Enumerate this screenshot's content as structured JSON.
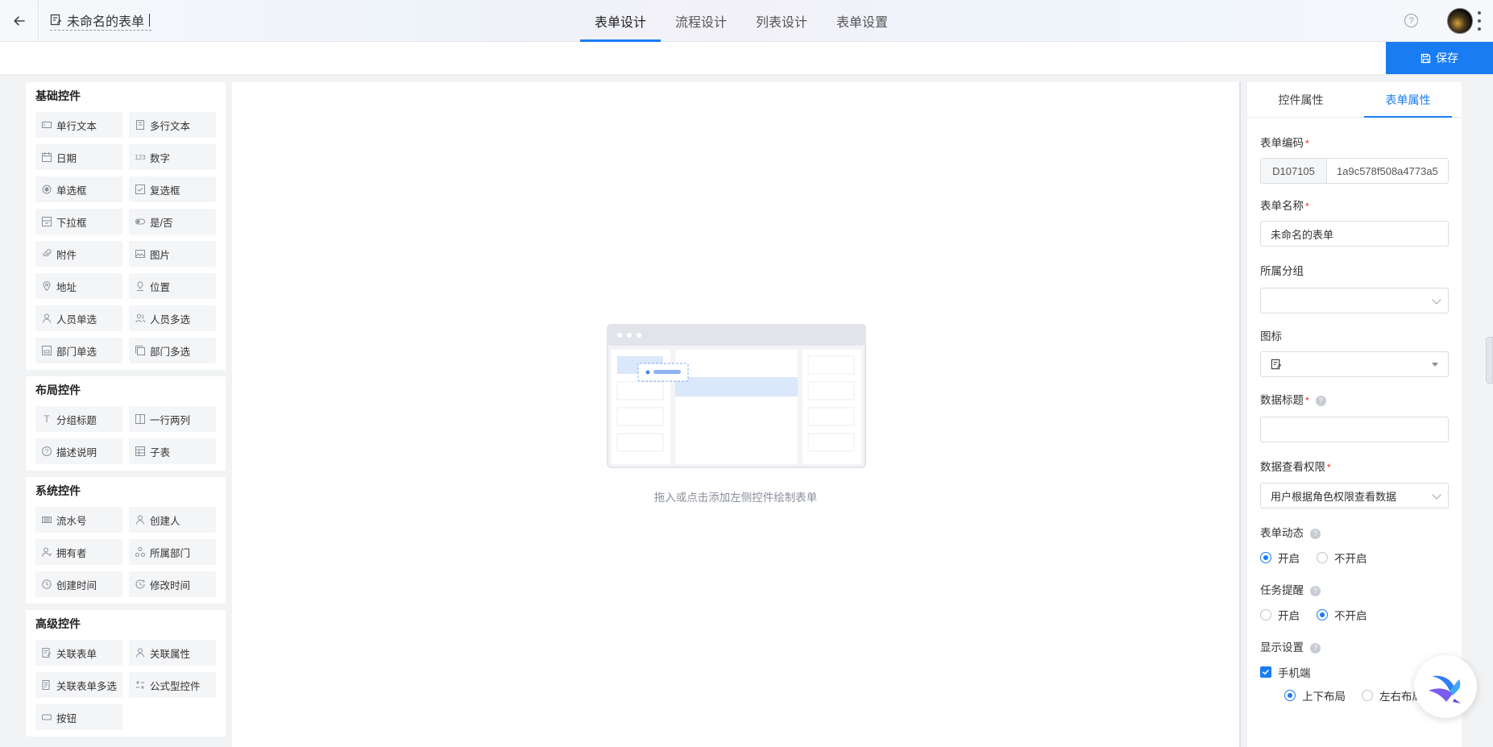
{
  "header": {
    "form_title": "未命名的表单",
    "tabs": [
      {
        "label": "表单设计",
        "active": true
      },
      {
        "label": "流程设计",
        "active": false
      },
      {
        "label": "列表设计",
        "active": false
      },
      {
        "label": "表单设置",
        "active": false
      }
    ],
    "help_icon": "question-circle-icon",
    "help_glyph": "?"
  },
  "toolbar": {
    "save_label": "保存"
  },
  "palette": {
    "groups": [
      {
        "title": "基础控件",
        "items": [
          {
            "label": "单行文本",
            "icon": "single-line-text-icon"
          },
          {
            "label": "多行文本",
            "icon": "multi-line-text-icon"
          },
          {
            "label": "日期",
            "icon": "calendar-icon"
          },
          {
            "label": "数字",
            "icon": "number-icon",
            "glyph": "123"
          },
          {
            "label": "单选框",
            "icon": "radio-icon"
          },
          {
            "label": "复选框",
            "icon": "checkbox-icon"
          },
          {
            "label": "下拉框",
            "icon": "dropdown-icon"
          },
          {
            "label": "是/否",
            "icon": "toggle-icon"
          },
          {
            "label": "附件",
            "icon": "paperclip-icon"
          },
          {
            "label": "图片",
            "icon": "image-icon"
          },
          {
            "label": "地址",
            "icon": "map-pin-icon"
          },
          {
            "label": "位置",
            "icon": "location-icon"
          },
          {
            "label": "人员单选",
            "icon": "user-icon"
          },
          {
            "label": "人员多选",
            "icon": "users-icon"
          },
          {
            "label": "部门单选",
            "icon": "department-icon"
          },
          {
            "label": "部门多选",
            "icon": "departments-icon"
          }
        ]
      },
      {
        "title": "布局控件",
        "items": [
          {
            "label": "分组标题",
            "icon": "text-title-icon",
            "glyph": "T"
          },
          {
            "label": "一行两列",
            "icon": "two-columns-icon"
          },
          {
            "label": "描述说明",
            "icon": "info-circle-icon",
            "glyph": "?"
          },
          {
            "label": "子表",
            "icon": "table-icon"
          }
        ]
      },
      {
        "title": "系统控件",
        "items": [
          {
            "label": "流水号",
            "icon": "barcode-icon"
          },
          {
            "label": "创建人",
            "icon": "user-icon"
          },
          {
            "label": "拥有者",
            "icon": "owner-icon"
          },
          {
            "label": "所属部门",
            "icon": "org-icon"
          },
          {
            "label": "创建时间",
            "icon": "clock-icon"
          },
          {
            "label": "修改时间",
            "icon": "clock-edit-icon"
          }
        ]
      },
      {
        "title": "高级控件",
        "items": [
          {
            "label": "关联表单",
            "icon": "link-form-icon"
          },
          {
            "label": "关联属性",
            "icon": "user-icon"
          },
          {
            "label": "关联表单多选",
            "icon": "link-forms-icon"
          },
          {
            "label": "公式型控件",
            "icon": "formula-icon"
          },
          {
            "label": "按钮",
            "icon": "button-icon"
          }
        ]
      }
    ]
  },
  "canvas": {
    "empty_hint": "拖入或点击添加左侧控件绘制表单"
  },
  "props": {
    "tabs": [
      {
        "label": "控件属性",
        "active": false
      },
      {
        "label": "表单属性",
        "active": true
      }
    ],
    "code_label": "表单编码",
    "code_prefix": "D107105",
    "code_value": "1a9c578f508a4773a5",
    "name_label": "表单名称",
    "name_value": "未命名的表单",
    "group_label": "所属分组",
    "group_value": "",
    "icon_label": "图标",
    "data_title_label": "数据标题",
    "data_title_value": "",
    "permission_label": "数据查看权限",
    "permission_value": "用户根据角色权限查看数据",
    "dynamic_label": "表单动态",
    "dynamic_on": "开启",
    "dynamic_off": "不开启",
    "dynamic_selected": "on",
    "reminder_label": "任务提醒",
    "reminder_on": "开启",
    "reminder_off": "不开启",
    "reminder_selected": "off",
    "display_label": "显示设置",
    "mobile_label": "手机端",
    "mobile_checked": true,
    "layout_vertical": "上下布局",
    "layout_horizontal": "左右布局",
    "layout_selected": "vertical",
    "required_mark": "*",
    "help_glyph": "?"
  },
  "colors": {
    "accent": "#1a7cf3",
    "required": "#f5222d"
  }
}
